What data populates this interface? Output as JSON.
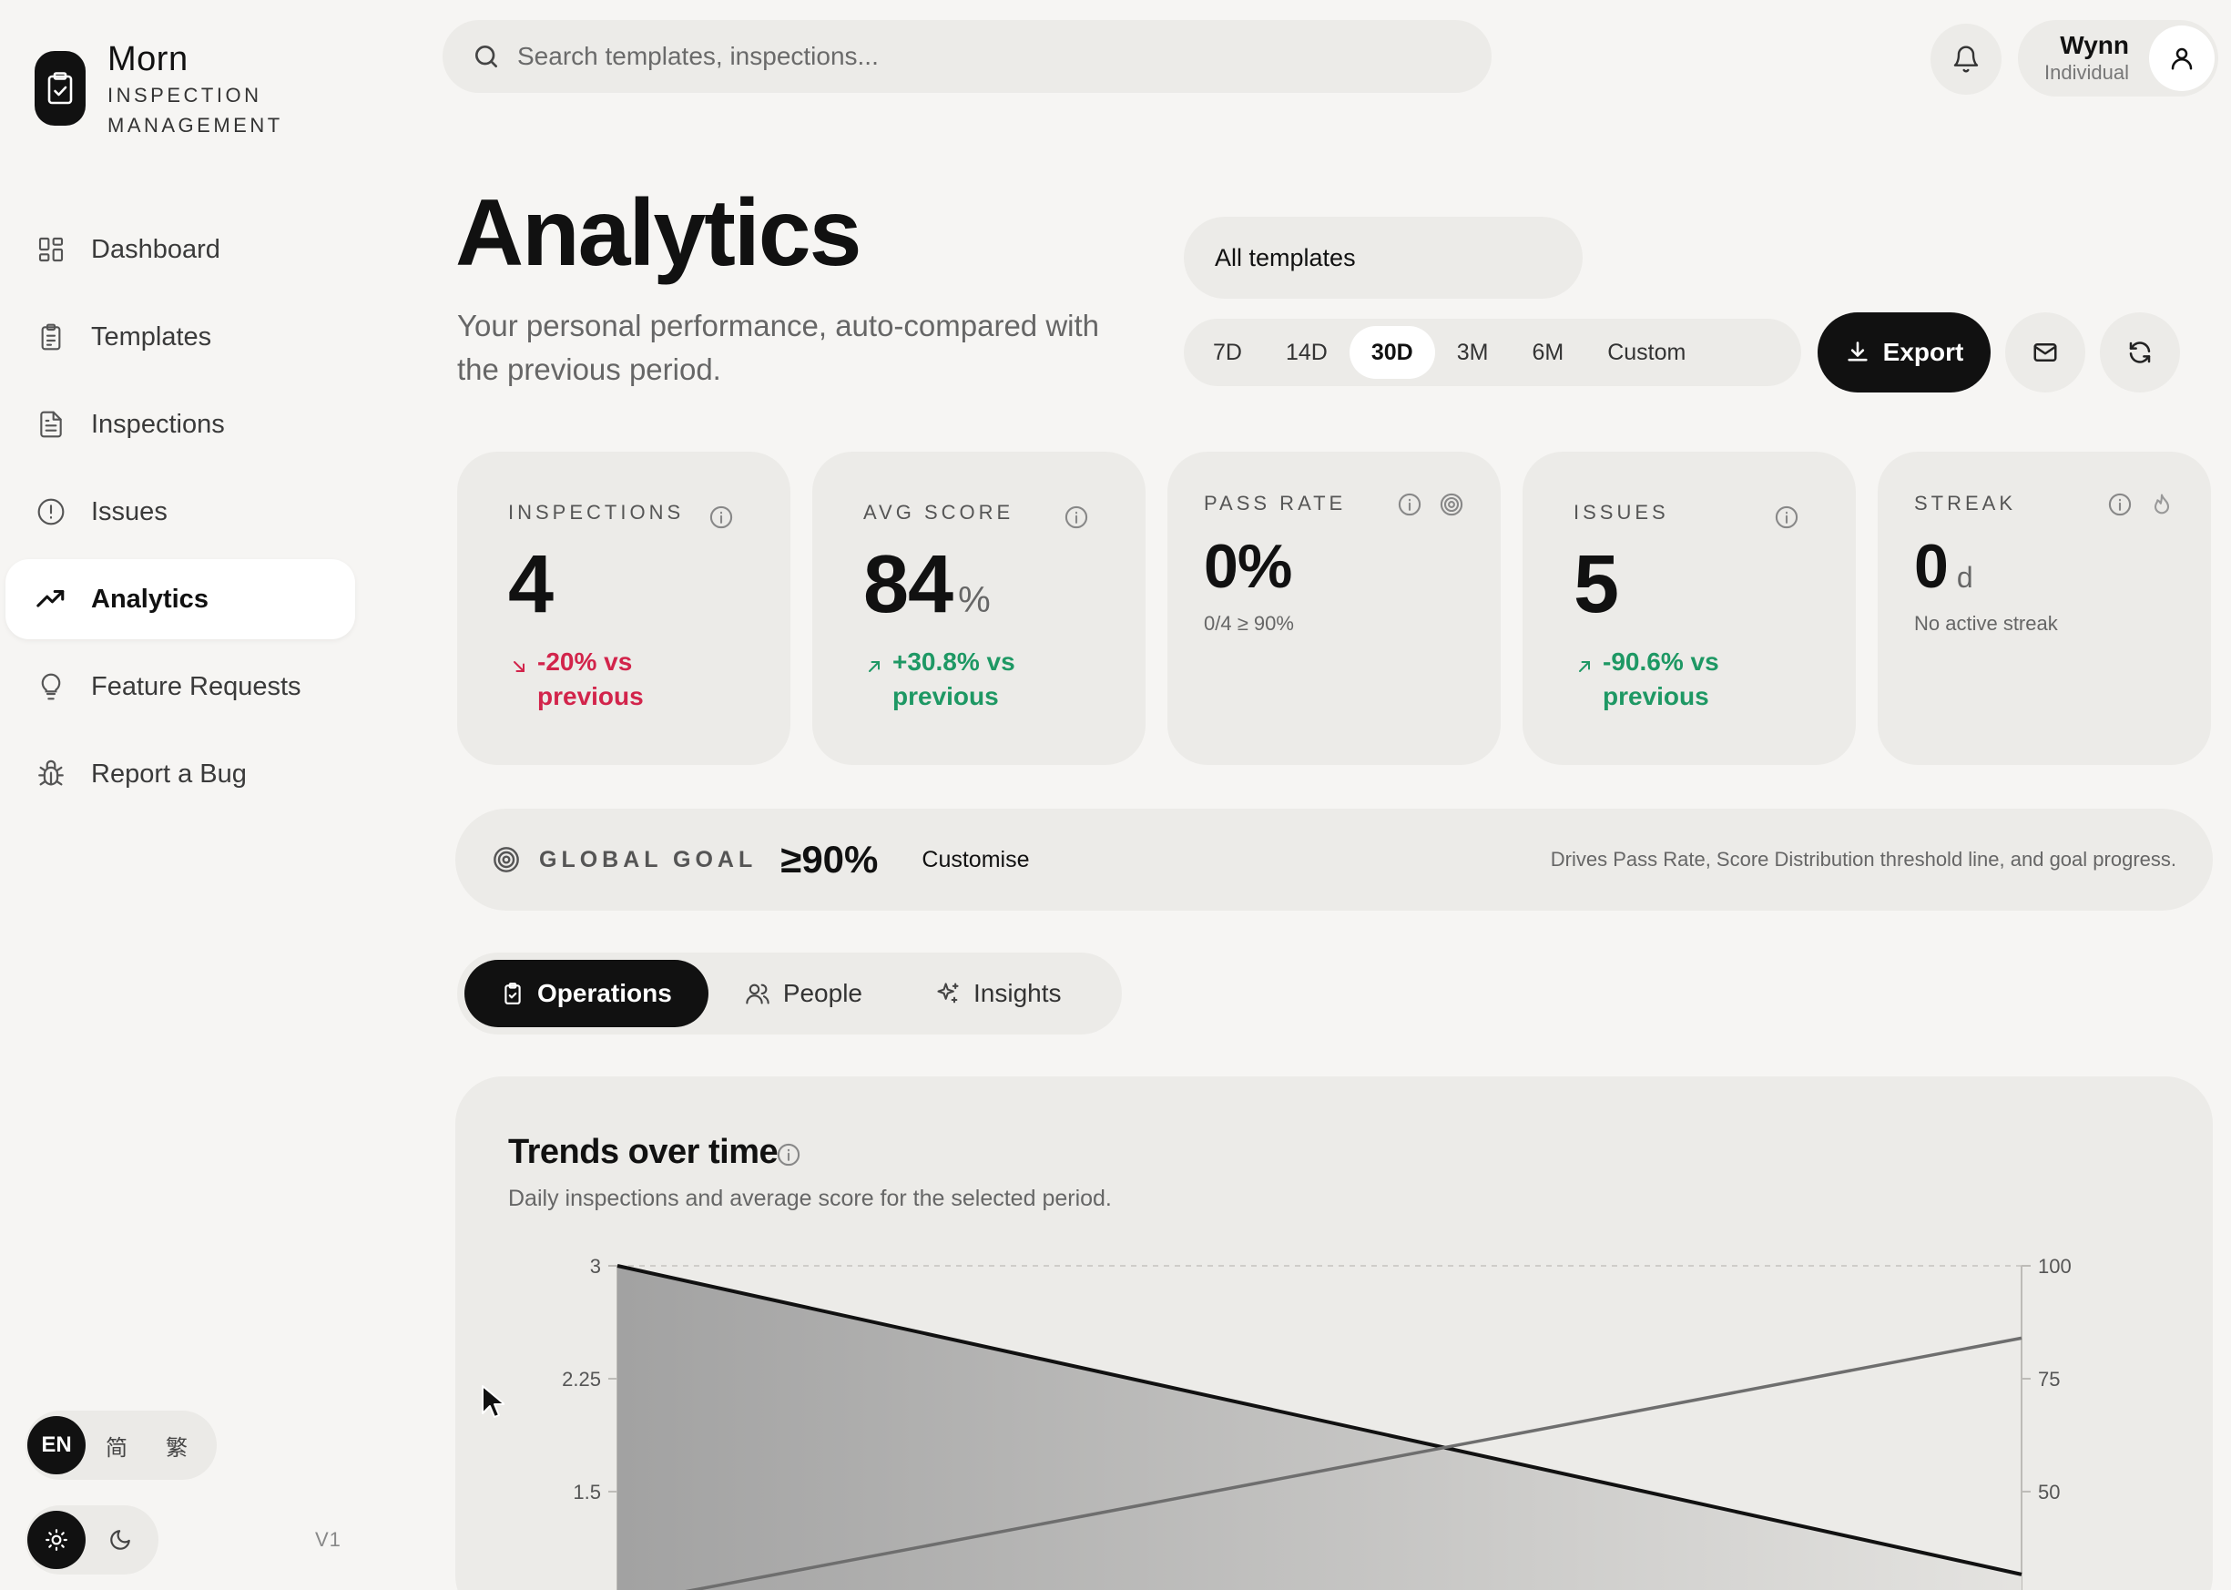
{
  "brand": {
    "name": "Morn",
    "subtitle": "INSPECTION MANAGEMENT"
  },
  "nav": {
    "items": [
      {
        "label": "Dashboard",
        "icon": "dashboard-icon"
      },
      {
        "label": "Templates",
        "icon": "clipboard-icon"
      },
      {
        "label": "Inspections",
        "icon": "document-icon"
      },
      {
        "label": "Issues",
        "icon": "alert-circle-icon"
      },
      {
        "label": "Analytics",
        "icon": "trending-up-icon",
        "active": true
      },
      {
        "label": "Feature Requests",
        "icon": "lightbulb-icon"
      },
      {
        "label": "Report a Bug",
        "icon": "bug-icon"
      }
    ]
  },
  "language": {
    "options": [
      "EN",
      "简",
      "繁"
    ],
    "selected": "EN"
  },
  "theme": {
    "selected": "light"
  },
  "version": "V1",
  "search": {
    "placeholder": "Search templates, inspections..."
  },
  "user": {
    "name": "Wynn",
    "role": "Individual"
  },
  "page": {
    "title": "Analytics",
    "subtitle": "Your personal performance, auto-compared with the previous period."
  },
  "filters": {
    "template": "All templates",
    "ranges": [
      "7D",
      "14D",
      "30D",
      "3M",
      "6M",
      "Custom"
    ],
    "selected_range": "30D",
    "export_label": "Export"
  },
  "kpis": {
    "inspections": {
      "label": "INSPECTIONS",
      "value": "4",
      "delta": "-20% vs previous",
      "trend": "down"
    },
    "avg_score": {
      "label": "AVG SCORE",
      "value": "84",
      "unit": "%",
      "delta": "+30.8% vs previous",
      "trend": "up"
    },
    "pass_rate": {
      "label": "PASS RATE",
      "value": "0%",
      "note": "0/4 ≥ 90%"
    },
    "issues": {
      "label": "ISSUES",
      "value": "5",
      "delta": "-90.6% vs previous",
      "trend": "up"
    },
    "streak": {
      "label": "STREAK",
      "value": "0",
      "unit": "d",
      "note": "No active streak"
    }
  },
  "goal": {
    "label": "GLOBAL GOAL",
    "value": "≥90%",
    "customise_label": "Customise",
    "description": "Drives Pass Rate, Score Distribution threshold line, and goal progress."
  },
  "tabs": [
    {
      "label": "Operations",
      "icon": "clipboard-check-icon",
      "active": true
    },
    {
      "label": "People",
      "icon": "users-icon"
    },
    {
      "label": "Insights",
      "icon": "sparkles-icon"
    }
  ],
  "trends": {
    "title": "Trends over time",
    "subtitle": "Daily inspections and average score for the selected period."
  },
  "colors": {
    "background": "#f6f5f3",
    "surface": "#ecebe8",
    "primary": "#111111",
    "negative": "#d2244b",
    "positive": "#1e9864"
  },
  "chart_data": {
    "type": "area",
    "left_axis": {
      "ticks": [
        "3",
        "2.25",
        "1.5"
      ],
      "range": [
        0,
        3
      ]
    },
    "right_axis": {
      "ticks": [
        "100",
        "75",
        "50"
      ],
      "range": [
        0,
        100
      ]
    },
    "series": [
      {
        "axis": "left",
        "style": "area",
        "x": [
          0,
          1
        ],
        "values": [
          3,
          0.95
        ]
      },
      {
        "axis": "right",
        "style": "line",
        "x": [
          0,
          1
        ],
        "values": [
          25,
          84
        ]
      }
    ]
  }
}
